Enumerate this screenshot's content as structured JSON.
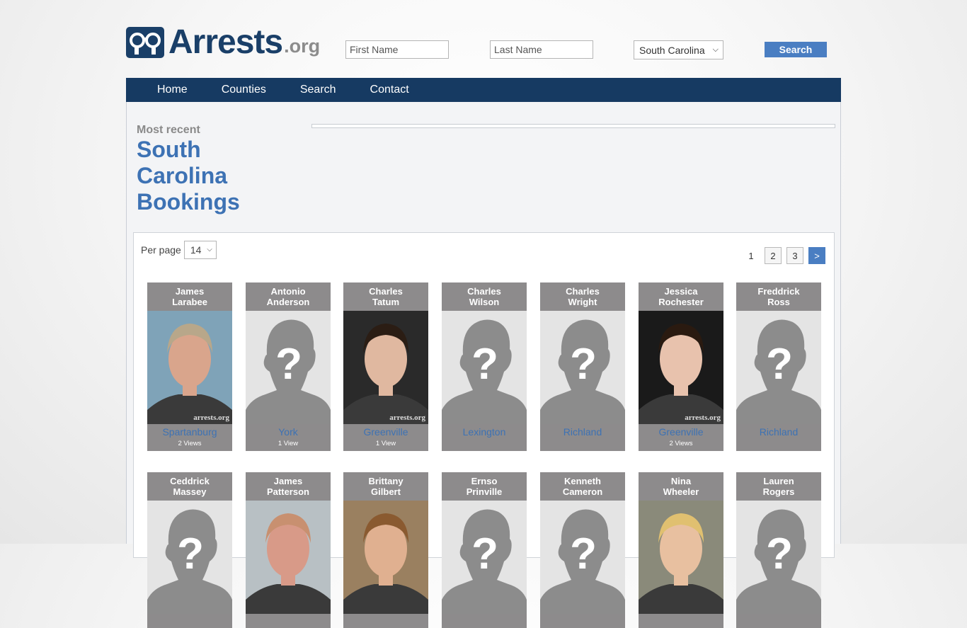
{
  "header": {
    "logo_main": "Arrests",
    "logo_suffix": ".org",
    "first_name_placeholder": "First Name",
    "last_name_placeholder": "Last Name",
    "state_selected": "South Carolina",
    "search_label": "Search"
  },
  "nav": [
    {
      "label": "Home"
    },
    {
      "label": "Counties"
    },
    {
      "label": "Search"
    },
    {
      "label": "Contact"
    }
  ],
  "intro": {
    "subtitle": "Most recent",
    "title_line1": "South",
    "title_line2": "Carolina",
    "title_line3": "Bookings"
  },
  "list": {
    "per_page_label": "Per page",
    "per_page_value": "14",
    "pages": [
      "1",
      "2",
      "3"
    ],
    "next_label": ">"
  },
  "people": [
    {
      "first": "James",
      "last": "Larabee",
      "county": "Spartanburg",
      "views": "2 Views",
      "photo": "photo-1",
      "watermark": "arrests.org"
    },
    {
      "first": "Antonio",
      "last": "Anderson",
      "county": "York",
      "views": "1 View",
      "photo": "placeholder"
    },
    {
      "first": "Charles",
      "last": "Tatum",
      "county": "Greenville",
      "views": "1 View",
      "photo": "photo-2",
      "watermark": "arrests.org"
    },
    {
      "first": "Charles",
      "last": "Wilson",
      "county": "Lexington",
      "views": "",
      "photo": "placeholder"
    },
    {
      "first": "Charles",
      "last": "Wright",
      "county": "Richland",
      "views": "",
      "photo": "placeholder"
    },
    {
      "first": "Jessica",
      "last": "Rochester",
      "county": "Greenville",
      "views": "2 Views",
      "photo": "photo-3",
      "watermark": "arrests.org"
    },
    {
      "first": "Freddrick",
      "last": "Ross",
      "county": "Richland",
      "views": "",
      "photo": "placeholder"
    },
    {
      "first": "Ceddrick",
      "last": "Massey",
      "county": "",
      "views": "",
      "photo": "placeholder"
    },
    {
      "first": "James",
      "last": "Patterson",
      "county": "",
      "views": "",
      "photo": "photo-4"
    },
    {
      "first": "Brittany",
      "last": "Gilbert",
      "county": "",
      "views": "",
      "photo": "photo-5"
    },
    {
      "first": "Ernso",
      "last": "Prinville",
      "county": "",
      "views": "",
      "photo": "placeholder"
    },
    {
      "first": "Kenneth",
      "last": "Cameron",
      "county": "",
      "views": "",
      "photo": "placeholder"
    },
    {
      "first": "Nina",
      "last": "Wheeler",
      "county": "",
      "views": "",
      "photo": "photo-6"
    },
    {
      "first": "Lauren",
      "last": "Rogers",
      "county": "",
      "views": "",
      "photo": "placeholder"
    }
  ],
  "colors": {
    "brand_navy": "#163a62",
    "accent_blue": "#4a7ec2",
    "title_blue": "#3d72b4",
    "card_gray": "#8d8b8c"
  }
}
